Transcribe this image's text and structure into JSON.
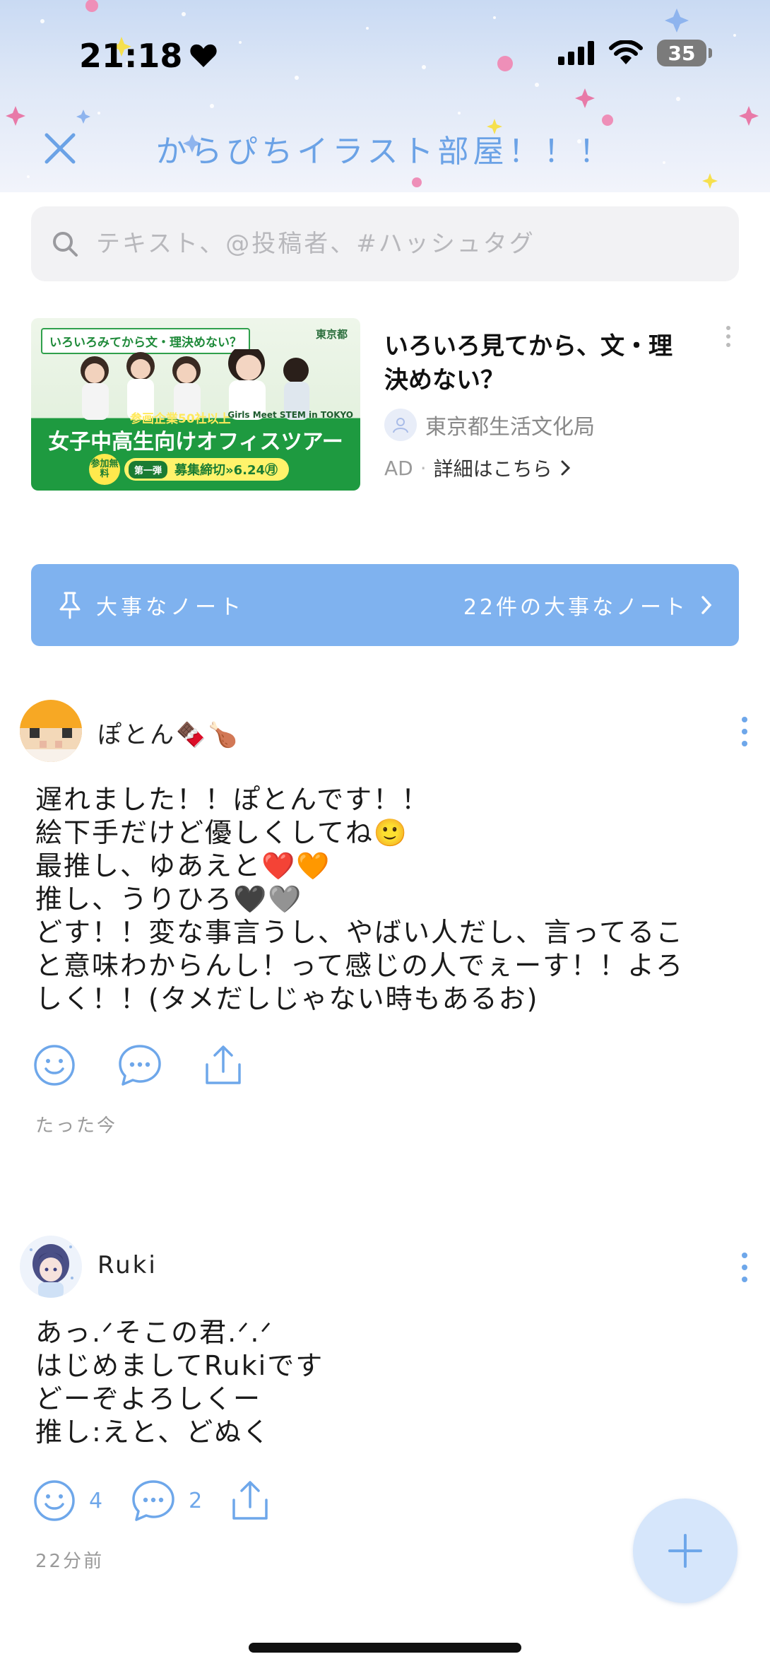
{
  "status_bar": {
    "time": "21:18",
    "battery": "35"
  },
  "header": {
    "title": "からぴちイラスト部屋！！！"
  },
  "search": {
    "placeholder": "テキスト、@投稿者、#ハッシュタグ"
  },
  "ad": {
    "banner_tagline": "いろいろみてから文・理決めない？",
    "banner_gov": "東京都",
    "banner_sub": "参画企業50社以上",
    "banner_brand": "Girls Meet STEM in TOKYO",
    "banner_main": "女子中高生向けオフィスツアー",
    "banner_free": "参加無料",
    "banner_chip": "第一弾",
    "banner_deadline": "募集締切»6.24㊊",
    "title": "いろいろ見てから、文・理決めない？",
    "sponsor": "東京都生活文化局",
    "label": "AD",
    "detail": "詳細はこちら"
  },
  "notes_bar": {
    "label": "大事なノート",
    "count_text": "22件の大事なノート"
  },
  "posts": [
    {
      "author": "ぽとん🍫🍗",
      "lines": [
        "遅れました！！ぽとんです！！",
        "絵下手だけど優しくしてね🙂",
        "最推し、ゆあえと❤️🧡",
        "推し、うりひろ🖤🩶",
        "どす！！変な事言うし、やばい人だし、言ってるこ",
        "と意味わからんし！って感じの人でぇーす！！よろ",
        "しく！！(タメだしじゃない時もあるお)"
      ],
      "reactions": "",
      "comments": "",
      "time": "たった今"
    },
    {
      "author": "Ruki",
      "lines": [
        "あっ.ᐟそこの君.ᐟ.ᐟ",
        "はじめましてRukiです",
        "どーぞよろしくー",
        "推し:えと、どぬく"
      ],
      "reactions": "4",
      "comments": "2",
      "time": "22分前"
    }
  ],
  "colors": {
    "accent": "#6ea7ea",
    "notes_bar": "#7fb2ef",
    "fab": "#d6e6fb"
  }
}
